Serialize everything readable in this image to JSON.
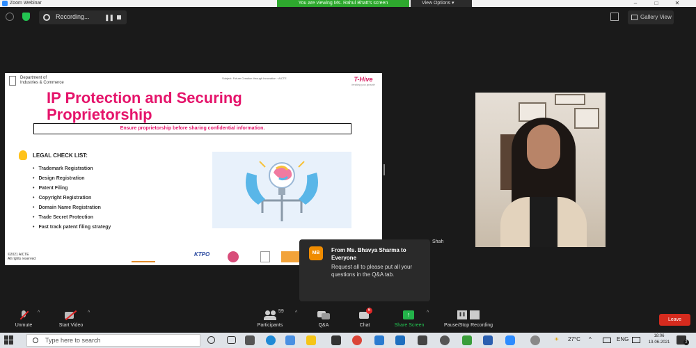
{
  "window": {
    "app_title": "Zoom Webinar",
    "viewing_banner": "You are viewing Ms. Rahul Bhatt's screen",
    "view_options": "View Options ▾"
  },
  "topbar": {
    "recording_label": "Recording...",
    "gallery_view": "Gallery View"
  },
  "slide": {
    "dept_line1": "Department of",
    "dept_line2": "Industries & Commerce",
    "subject_line": "Subject: Future Creation through Innovation · AICTE",
    "logo_text": "T-Hive",
    "logo_sub": "lending you growth",
    "title": "IP Protection and Securing Proprietorship",
    "callout": "Ensure proprietorship before sharing confidential information.",
    "checklist_title": "LEGAL CHECK LIST:",
    "checklist": [
      "Trademark Registration",
      "Design Registration",
      "Patent Filing",
      "Copyright Registration",
      "Domain Name Registration",
      "Trade Secret Protection",
      "Fast track patent filing strategy"
    ],
    "copyright_line1": "©2021 AICTE",
    "copyright_line2": "All rights reserved",
    "sponsors": [
      "KTPO"
    ]
  },
  "video": {
    "participant_name": "Shah"
  },
  "chat_popup": {
    "avatar_initials": "MB",
    "from": "From Ms. Bhavya Sharma to Everyone",
    "message": "Request all to please put all your questions in the Q&A tab."
  },
  "toolbar": {
    "unmute": "Unmute",
    "start_video": "Start Video",
    "participants": "Participants",
    "participants_count": "59",
    "qa": "Q&A",
    "chat": "Chat",
    "chat_badge": "6",
    "share_screen": "Share Screen",
    "pause_stop_recording": "Pause/Stop Recording",
    "leave": "Leave"
  },
  "taskbar": {
    "search_placeholder": "Type here to search",
    "weather": "27°C",
    "language": "ENG",
    "time": "18:06",
    "date": "13-06-2021",
    "notification_count": "2"
  },
  "colors": {
    "accent_pink": "#e5146b",
    "share_green": "#23c552",
    "leave_red": "#d52b1e",
    "banner_green": "#2ea82e"
  }
}
